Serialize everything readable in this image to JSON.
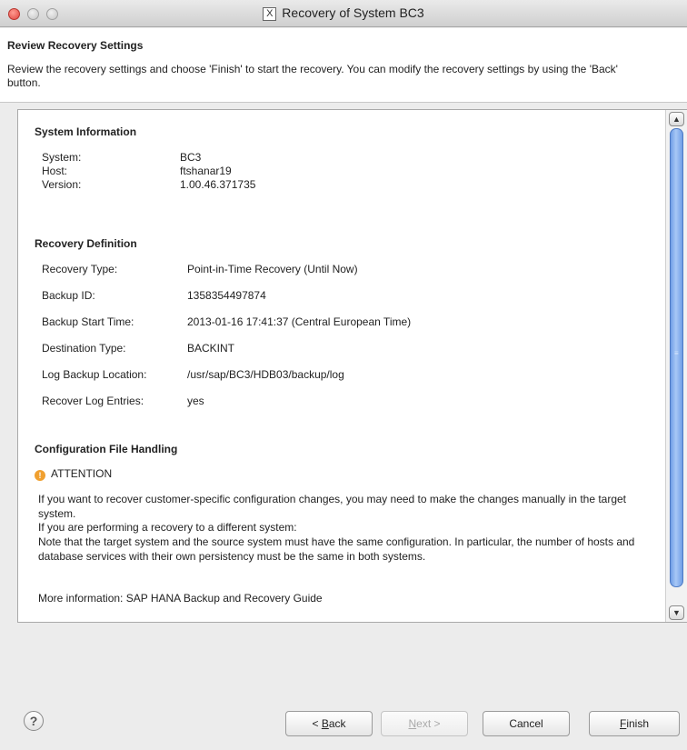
{
  "window": {
    "title": "Recovery of System BC3",
    "app_icon": "x-window-icon"
  },
  "header": {
    "title": "Review Recovery Settings",
    "description": "Review the recovery settings and choose 'Finish' to start the recovery. You can modify the recovery settings by using the 'Back' button."
  },
  "system_info": {
    "title": "System Information",
    "rows": [
      {
        "label": "System:",
        "value": "BC3"
      },
      {
        "label": "Host:",
        "value": "ftshanar19"
      },
      {
        "label": "Version:",
        "value": "1.00.46.371735"
      }
    ]
  },
  "recovery_definition": {
    "title": "Recovery Definition",
    "rows": [
      {
        "label": "Recovery Type:",
        "value": "Point-in-Time Recovery (Until Now)"
      },
      {
        "label": "Backup ID:",
        "value": "1358354497874"
      },
      {
        "label": "Backup Start Time:",
        "value": "2013-01-16 17:41:37 (Central European Time)"
      },
      {
        "label": "Destination Type:",
        "value": "BACKINT"
      },
      {
        "label": "Log Backup Location:",
        "value": "/usr/sap/BC3/HDB03/backup/log"
      },
      {
        "label": "Recover Log Entries:",
        "value": "yes"
      }
    ]
  },
  "config_handling": {
    "title": "Configuration File Handling",
    "attention": "ATTENTION",
    "paragraph1": "If you want to recover customer-specific configuration changes, you may need to make the changes manually in the target system.",
    "paragraph2": "If you are performing a recovery to a different system:",
    "paragraph3": "Note that the target system and the source system must have the same configuration. In particular, the number of hosts and database services with their own persistency must be the same in both systems.",
    "paragraph4": "More information: SAP HANA Backup and Recovery Guide"
  },
  "footer": {
    "help": "?",
    "back": {
      "prefix": "< ",
      "mnemonic": "B",
      "rest": "ack"
    },
    "next": {
      "mnemonic": "N",
      "rest": "ext >"
    },
    "cancel": "Cancel",
    "finish": {
      "mnemonic": "F",
      "rest": "inish"
    }
  },
  "colors": {
    "scroll_thumb": "#6f9ee6",
    "attention_icon": "#f0a030"
  }
}
